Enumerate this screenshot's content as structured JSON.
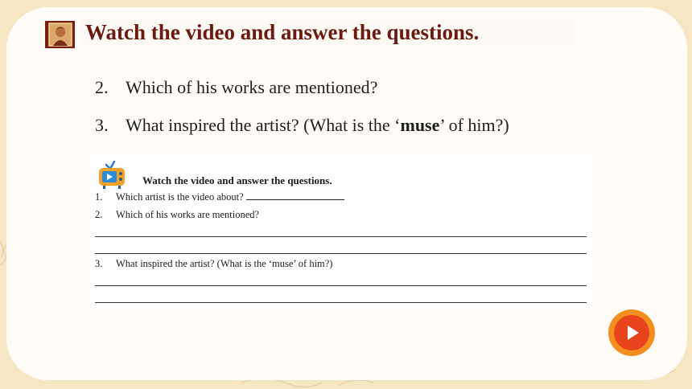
{
  "header": {
    "title": "Watch the video and answer the questions."
  },
  "questions": [
    {
      "number": "2.",
      "text": "Which of his works are mentioned?"
    },
    {
      "number": "3.",
      "before": "What inspired the artist? (What is the ‘",
      "bold": "muse",
      "after": "’ of him?)"
    }
  ],
  "worksheet": {
    "title": "Watch the video and answer the questions.",
    "items": [
      {
        "number": "1.",
        "text": "Which artist is the video about?"
      },
      {
        "number": "2.",
        "text": "Which of his works are mentioned?"
      },
      {
        "number": "3.",
        "text": "What inspired the artist? (What is the ‘muse’ of him?)"
      }
    ]
  },
  "colors": {
    "title": "#6b1a10",
    "card": "#fffcf8",
    "page_bg": "#f7e6c4",
    "play_outer": "#f48e1e",
    "play_inner": "#e8441c"
  },
  "icons": {
    "logo": "portrait-logo-icon",
    "tv": "tv-icon",
    "play": "play-icon"
  }
}
